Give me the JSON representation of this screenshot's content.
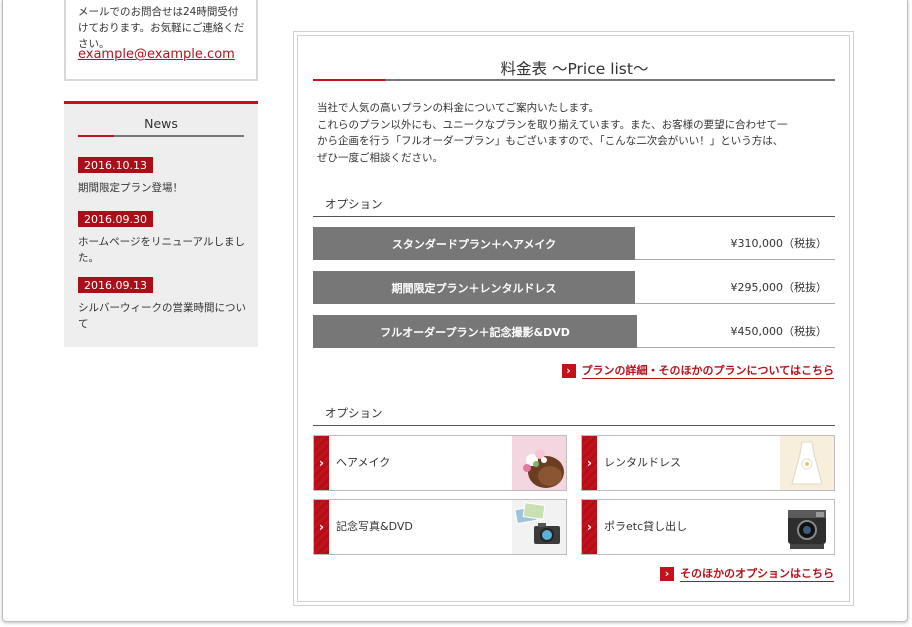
{
  "sidebar": {
    "contact": {
      "text_lines": [
        "メールでのお問合せは24時間受付",
        "けております。お気軽にご連絡くだ",
        "さい。"
      ],
      "email": "example@example.com"
    },
    "news": {
      "title": "News",
      "items": [
        {
          "date": "2016.10.13",
          "text": "期間限定プラン登場！"
        },
        {
          "date": "2016.09.30",
          "text": "ホームページをリニューアルしました。"
        },
        {
          "date": "2016.09.13",
          "text": "シルバーウィークの営業時間について"
        }
      ]
    }
  },
  "main": {
    "title": "料金表 〜Price list〜",
    "intro_lines": [
      "当社で人気の高いプランの料金についてご案内いたします。",
      "これらのプラン以外にも、ユニークなプランを取り揃えています。また、お客様の要望に合わせて一",
      "から企画を行う「フルオーダープラン」もございますので、「こんな二次会がいい！」という方は、",
      "ぜひ一度ご相談ください。"
    ],
    "section1_title": "オプション",
    "plans": [
      {
        "name": "スタンダードプラン＋ヘアメイク",
        "price": "¥310,000（税抜）"
      },
      {
        "name": "期間限定プラン＋レンタルドレス",
        "price": "¥295,000（税抜）"
      },
      {
        "name": "フルオーダープラン＋記念撮影&DVD",
        "price": "¥450,000（税抜）"
      }
    ],
    "plans_link": "プランの詳細・そのほかのプランについてはこちら",
    "section2_title": "オプション",
    "options": [
      {
        "label": "ヘアメイク",
        "icon": "hair-flower-photo"
      },
      {
        "label": "レンタルドレス",
        "icon": "dress-photo"
      },
      {
        "label": "記念写真&DVD",
        "icon": "camera-photos-photo"
      },
      {
        "label": "ポラetc貸し出し",
        "icon": "polaroid-camera-photo"
      }
    ],
    "options_link": "そのほかのオプションはこちら",
    "arrow_glyph": "›"
  },
  "colors": {
    "accent": "#c4121d",
    "plan_label_bg": "#777777",
    "news_bg": "#eeeeee"
  }
}
